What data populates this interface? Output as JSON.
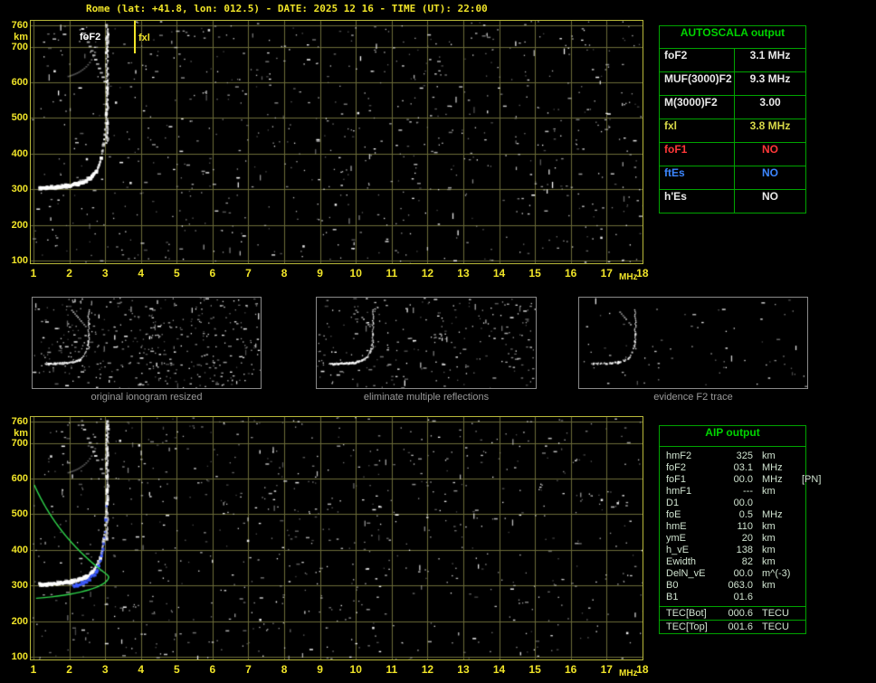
{
  "header": {
    "title": "Rome (lat: +41.8, lon: 012.5) - DATE: 2025 12 16 - TIME (UT): 22:00"
  },
  "colors": {
    "yellow": "#f0e428",
    "green_border": "#00a400",
    "green_text": "#00d400",
    "value_white": "#e8e8e8",
    "red": "#ff3838",
    "blue": "#3c86ff",
    "fxI_yellow": "#d8d848",
    "grid": "#6a6a38",
    "plot_border": "#b9b93a",
    "caption_gray": "#9a9a9a",
    "aip_text": "#cfe2cf",
    "trace_white": "#ffffff",
    "trace_blue": "#3d5bff",
    "profile_green": "#2ed24a"
  },
  "plots": {
    "y_unit": "km",
    "x_unit": "MHz",
    "y_ticks": [
      760,
      700,
      600,
      500,
      400,
      300,
      200,
      100
    ],
    "x_ticks": [
      1,
      2,
      3,
      4,
      5,
      6,
      7,
      8,
      9,
      10,
      11,
      12,
      13,
      14,
      15,
      16,
      17,
      18
    ],
    "trace": {
      "foF2_MHz": 3.1,
      "fxI_MHz": 3.8,
      "base_height_km": 300,
      "hmF2_km": 325
    }
  },
  "top_plot": {
    "foF2_label": "foF2",
    "fxI_label": "fxl"
  },
  "autoscala": {
    "title": "AUTOSCALA output",
    "rows": [
      {
        "label": "foF2",
        "value": "3.1 MHz",
        "color": "white"
      },
      {
        "label": "MUF(3000)F2",
        "value": "9.3 MHz",
        "color": "white"
      },
      {
        "label": "M(3000)F2",
        "value": "3.00",
        "color": "white"
      },
      {
        "label": "fxl",
        "value": "3.8 MHz",
        "color": "yellow"
      },
      {
        "label": "foF1",
        "value": "NO",
        "color": "red"
      },
      {
        "label": "ftEs",
        "value": "NO",
        "color": "blue"
      },
      {
        "label": "h'Es",
        "value": "NO",
        "color": "white"
      }
    ]
  },
  "thumbnails": [
    {
      "caption": "original ionogram resized"
    },
    {
      "caption": "eliminate multiple reflections"
    },
    {
      "caption": "evidence F2 trace"
    }
  ],
  "aip": {
    "title": "AIP output",
    "rows": [
      {
        "name": "hmF2",
        "value": "325",
        "unit": "km",
        "note": ""
      },
      {
        "name": "foF2",
        "value": "03.1",
        "unit": "MHz",
        "note": ""
      },
      {
        "name": "foF1",
        "value": "00.0",
        "unit": "MHz",
        "note": "[PN]"
      },
      {
        "name": "hmF1",
        "value": "---",
        "unit": "km",
        "note": ""
      },
      {
        "name": "D1",
        "value": "00.0",
        "unit": "",
        "note": ""
      },
      {
        "name": "foE",
        "value": "0.5",
        "unit": "MHz",
        "note": ""
      },
      {
        "name": "hmE",
        "value": "110",
        "unit": "km",
        "note": ""
      },
      {
        "name": "ymE",
        "value": "20",
        "unit": "km",
        "note": ""
      },
      {
        "name": "h_vE",
        "value": "138",
        "unit": "km",
        "note": ""
      },
      {
        "name": "Ewidth",
        "value": "82",
        "unit": "km",
        "note": ""
      },
      {
        "name": "DelN_vE",
        "value": "00.0",
        "unit": "m^(-3)",
        "note": ""
      },
      {
        "name": "B0",
        "value": "063.0",
        "unit": "km",
        "note": ""
      },
      {
        "name": "B1",
        "value": "01.6",
        "unit": "",
        "note": ""
      }
    ],
    "tec_rows": [
      {
        "name": "TEC[Bot]",
        "value": "000.6",
        "unit": "TECU"
      },
      {
        "name": "TEC[Top]",
        "value": "001.6",
        "unit": "TECU"
      }
    ]
  }
}
